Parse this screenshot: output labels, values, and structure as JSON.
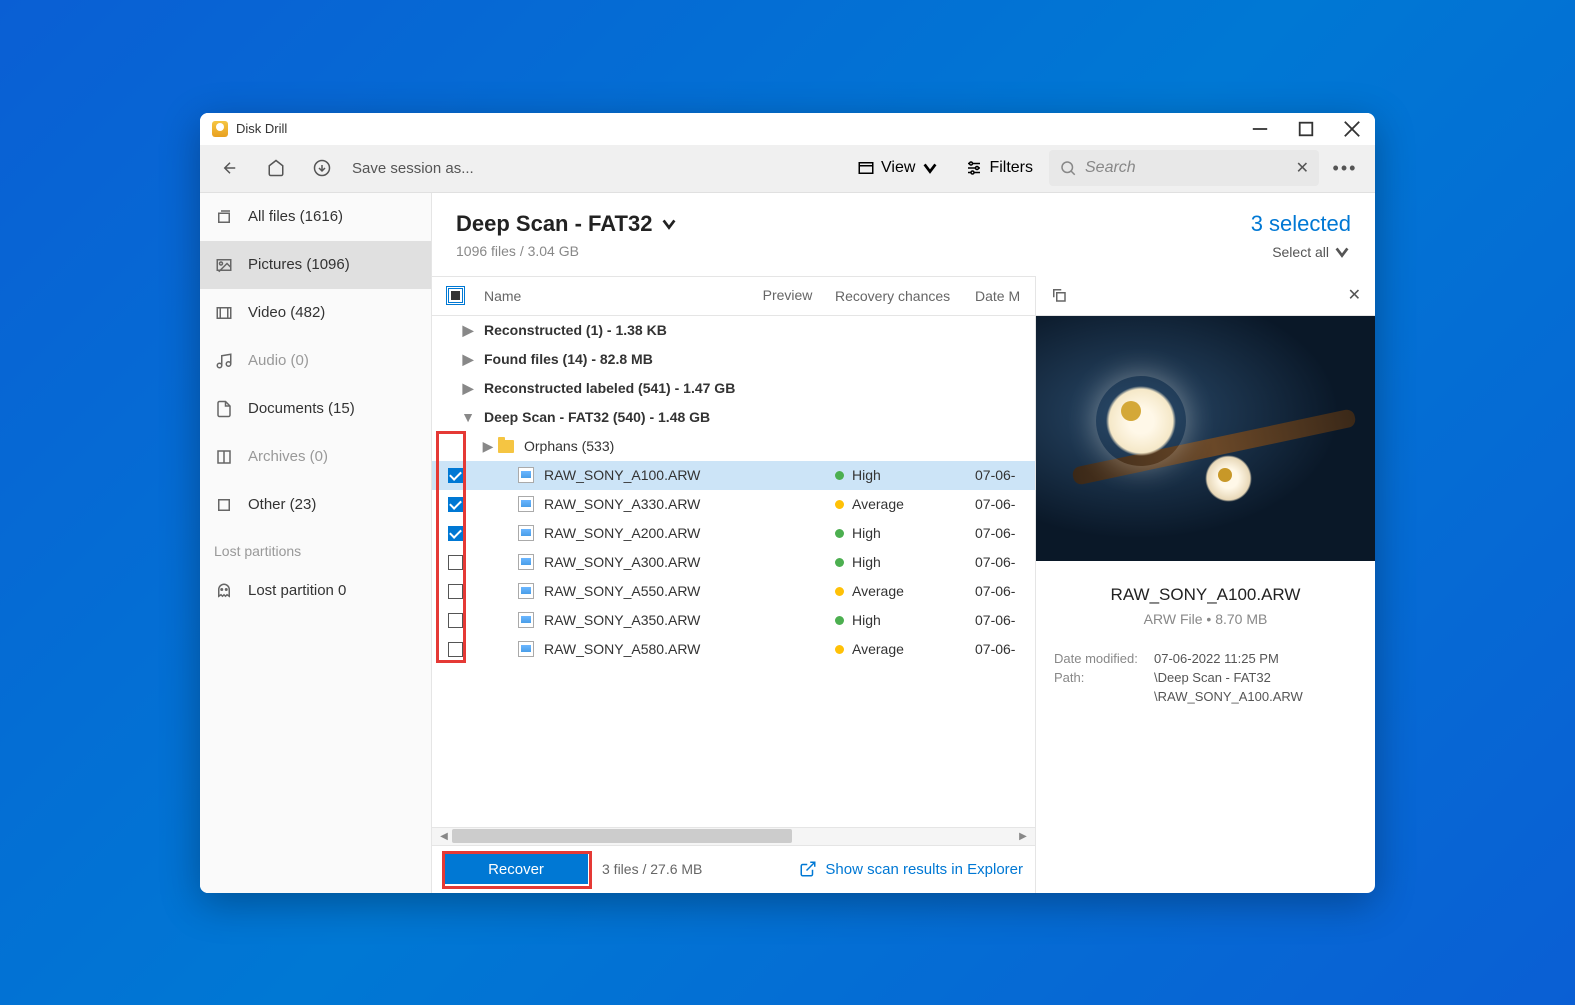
{
  "titlebar": {
    "app_name": "Disk Drill"
  },
  "toolbar": {
    "save_session": "Save session as...",
    "view": "View",
    "filters": "Filters",
    "search_placeholder": "Search"
  },
  "sidebar": {
    "items": [
      {
        "label": "All files (1616)"
      },
      {
        "label": "Pictures (1096)"
      },
      {
        "label": "Video (482)"
      },
      {
        "label": "Audio (0)"
      },
      {
        "label": "Documents (15)"
      },
      {
        "label": "Archives (0)"
      },
      {
        "label": "Other (23)"
      }
    ],
    "section": "Lost partitions",
    "lost_partition": "Lost partition 0"
  },
  "main": {
    "title": "Deep Scan - FAT32",
    "subtitle": "1096 files / 3.04 GB",
    "selected": "3 selected",
    "select_all": "Select all"
  },
  "columns": {
    "name": "Name",
    "recovery": "Recovery chances",
    "date": "Date M",
    "preview": "Preview"
  },
  "groups": [
    {
      "label": "Reconstructed (1) - 1.38 KB"
    },
    {
      "label": "Found files (14) - 82.8 MB"
    },
    {
      "label": "Reconstructed labeled (541) - 1.47 GB"
    },
    {
      "label": "Deep Scan - FAT32 (540) - 1.48 GB"
    }
  ],
  "orphans": "Orphans (533)",
  "files": [
    {
      "name": "RAW_SONY_A100.ARW",
      "chance": "High",
      "chance_color": "green",
      "date": "07-06-",
      "checked": true,
      "selected": true
    },
    {
      "name": "RAW_SONY_A330.ARW",
      "chance": "Average",
      "chance_color": "yellow",
      "date": "07-06-",
      "checked": true
    },
    {
      "name": "RAW_SONY_A200.ARW",
      "chance": "High",
      "chance_color": "green",
      "date": "07-06-",
      "checked": true
    },
    {
      "name": "RAW_SONY_A300.ARW",
      "chance": "High",
      "chance_color": "green",
      "date": "07-06-",
      "checked": false
    },
    {
      "name": "RAW_SONY_A550.ARW",
      "chance": "Average",
      "chance_color": "yellow",
      "date": "07-06-",
      "checked": false
    },
    {
      "name": "RAW_SONY_A350.ARW",
      "chance": "High",
      "chance_color": "green",
      "date": "07-06-",
      "checked": false
    },
    {
      "name": "RAW_SONY_A580.ARW",
      "chance": "Average",
      "chance_color": "yellow",
      "date": "07-06-",
      "checked": false
    }
  ],
  "footer": {
    "recover": "Recover",
    "summary": "3 files / 27.6 MB",
    "explorer_link": "Show scan results in Explorer"
  },
  "preview": {
    "filename": "RAW_SONY_A100.ARW",
    "meta": "ARW File • 8.70 MB",
    "date_label": "Date modified:",
    "date_value": "07-06-2022 11:25 PM",
    "path_label": "Path:",
    "path_value1": "\\Deep Scan - FAT32",
    "path_value2": "\\RAW_SONY_A100.ARW"
  }
}
